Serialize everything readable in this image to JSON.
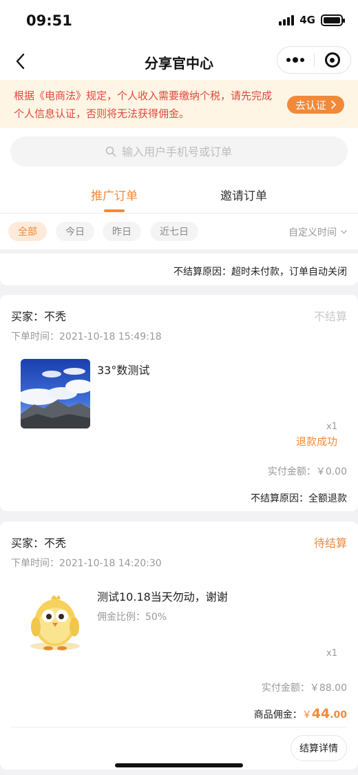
{
  "status_bar": {
    "time": "09:51",
    "network": "4G"
  },
  "nav": {
    "title": "分享官中心"
  },
  "notice": {
    "text": "根据《电商法》规定，个人收入需要缴纳个税，请先完成个人信息认证，否则将无法获得佣金。",
    "button_label": "去认证"
  },
  "search": {
    "placeholder": "输入用户手机号或订单"
  },
  "tabs": [
    {
      "label": "推广订单",
      "active": true
    },
    {
      "label": "邀请订单",
      "active": false
    }
  ],
  "filters": {
    "chips": [
      {
        "label": "全部",
        "active": true
      },
      {
        "label": "今日",
        "active": false
      },
      {
        "label": "昨日",
        "active": false
      },
      {
        "label": "近七日",
        "active": false
      }
    ],
    "custom_time": "自定义时间"
  },
  "orders": [
    {
      "settle_reason": "不结算原因：超时未付款，订单自动关闭"
    },
    {
      "buyer": "买家：不秃",
      "status": "不结算",
      "order_time": "下单时间：2021-10-18 15:49:18",
      "product_name": "33°数测试",
      "quantity": "x1",
      "refund_status": "退款成功",
      "paid_label": "实付金额：",
      "paid_amount": "￥0.00",
      "settle_reason": "不结算原因：全额退款"
    },
    {
      "buyer": "买家：不秃",
      "status": "待结算",
      "order_time": "下单时间：2021-10-18 14:20:30",
      "product_name": "测试10.18当天勿动，谢谢",
      "commission_rate": "佣金比例：50%",
      "quantity": "x1",
      "paid_label": "实付金额：",
      "paid_amount": "￥88.00",
      "commission_label": "商品佣金：",
      "commission_currency": "￥",
      "commission_int": "44",
      "commission_dec": ".00",
      "detail_button": "结算详情"
    }
  ],
  "colors": {
    "accent": "#f08a3a",
    "warning_text": "#e2483d",
    "notice_bg": "#fef5e5"
  }
}
